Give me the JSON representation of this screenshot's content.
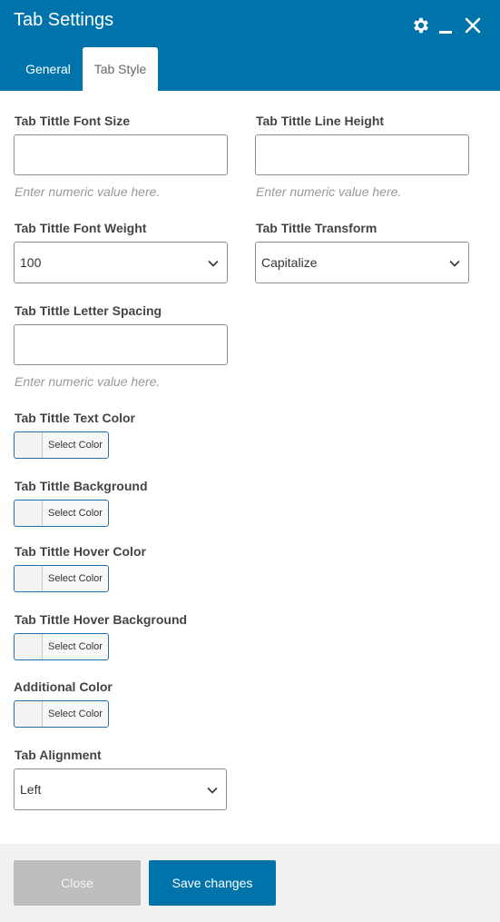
{
  "header": {
    "title": "Tab Settings",
    "icons": [
      "gear-icon",
      "minimize-icon",
      "close-icon"
    ],
    "accent": "#0073aa"
  },
  "tabs": [
    {
      "label": "General",
      "active": false
    },
    {
      "label": "Tab Style",
      "active": true
    }
  ],
  "form": {
    "font_size": {
      "label": "Tab Tittle Font Size",
      "value": "",
      "hint": "Enter numeric value here."
    },
    "line_height": {
      "label": "Tab Tittle Line Height",
      "value": "",
      "hint": "Enter numeric value here."
    },
    "font_weight": {
      "label": "Tab Tittle Font Weight",
      "value": "100"
    },
    "transform": {
      "label": "Tab Tittle Transform",
      "value": "Capitalize"
    },
    "letter_spacing": {
      "label": "Tab Tittle Letter Spacing",
      "value": "",
      "hint": "Enter numeric value here."
    },
    "text_color": {
      "label": "Tab Tittle Text Color",
      "button": "Select Color"
    },
    "background": {
      "label": "Tab Tittle Background",
      "button": "Select Color"
    },
    "hover_color": {
      "label": "Tab Tittle Hover Color",
      "button": "Select Color"
    },
    "hover_background": {
      "label": "Tab Tittle Hover Background",
      "button": "Select Color"
    },
    "additional_color": {
      "label": "Additional Color",
      "button": "Select Color"
    },
    "alignment": {
      "label": "Tab Alignment",
      "value": "Left"
    }
  },
  "footer": {
    "close_label": "Close",
    "save_label": "Save changes"
  }
}
